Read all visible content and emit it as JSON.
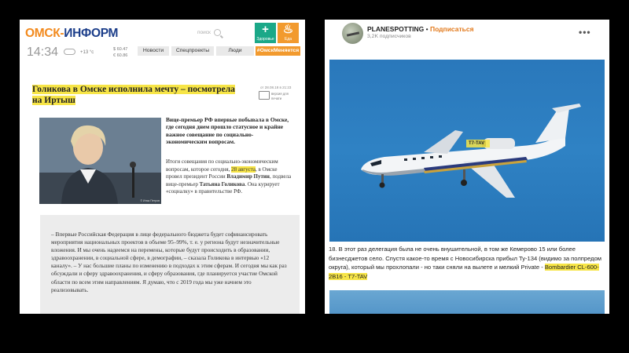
{
  "left": {
    "logo": {
      "part1": "ОМСК-",
      "part2": "ИНФОРМ"
    },
    "search_label": "поиск",
    "tiles": [
      {
        "label": "Здоровье",
        "glyph": "+",
        "color": "#1ba888"
      },
      {
        "label": "Еда",
        "glyph": "♨",
        "color": "#f29a2e"
      }
    ],
    "time": "14:34",
    "temperature": "+13 °c",
    "rates": {
      "usd": "$ 60.47",
      "eur": "€ 60.86"
    },
    "nav": [
      "Новости",
      "Спецпроекты",
      "Люди",
      "#ОмскМеняется"
    ],
    "headline": "Голикова в Омске исполнила мечту – посмотрела на Иртыш",
    "date": "от 28.08.18 в 21:23",
    "print_label": "версия для печати",
    "photo_caption": "© Илья Петров",
    "lead": "Вице-премьер РФ впервые побывала в Омске, где сегодня днем прошло статусное и крайне важное совещание по социально-экономическим вопросам.",
    "body": {
      "p1": "Итоги совещания по социально-экономическим вопросам, которое сегодня,",
      "date_hl": "28 августа",
      "p2": ", в Омске провел президент России",
      "president": "Владимир Путин",
      "p3": ", подвела вице-премьер",
      "golikova": "Татьяна Голикова",
      "p4": ". Она курирует «соцналку» в правительстве РФ."
    },
    "quote": "– Впервые Российская Федерация в лице федерального бюджета будет софинансировать мероприятия национальных проектов в объеме 95–99%, т. е. у региона будут незначительные вложения. И мы очень надеемся на перемены, которые будут происходить в образовании, здравоохранении, в социальной сфере, в демографии, – сказала Голикова в интервью «12 каналу». – У нас большие планы по изменению в подходах к этим сферам. И сегодня мы как раз обсуждали и сферу здравоохранения, и сферу образования, где планируется участие Омской области по всем этим направлениям. Я думаю, что с 2019 года мы уже начнем это реализовывать."
  },
  "right": {
    "channel_name": "PLANESPOTTING",
    "separator": " • ",
    "subscribe": "Подписаться",
    "subscribers": "3,2K подписчиков",
    "menu": "•••",
    "reg_label": "T7-TAV",
    "post_text": "18. В этот раз делегация была не очень внушительной, в том же Кемерово 15 или более бизнесджетов село. Спустя какое-то время с Новосибирска прибыл Ту-134 (видимо за полпредом округа), который мы прохлопали - но таки сняли на вылете и мелкий Private - ",
    "post_highlight": "Bombardier CL-600-2B16 - T7-TAV"
  }
}
